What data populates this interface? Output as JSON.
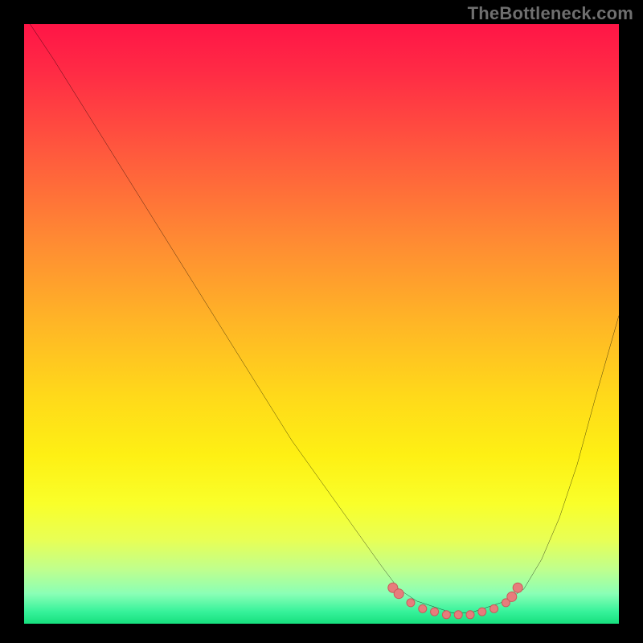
{
  "watermark": "TheBottleneck.com",
  "colors": {
    "frame": "#000000",
    "watermark": "#6f6f6f",
    "curve": "#000000",
    "markers_fill": "#e77c7c",
    "markers_stroke": "#c95a5a",
    "gradient_stops": [
      "#ff1546",
      "#ff2b45",
      "#ff5b3d",
      "#ff8a33",
      "#ffb626",
      "#ffd91a",
      "#fef014",
      "#f9ff2a",
      "#e8ff55",
      "#bfff8e",
      "#8affb6",
      "#36f29a",
      "#17e07e"
    ]
  },
  "chart_data": {
    "type": "line",
    "title": "",
    "xlabel": "",
    "ylabel": "",
    "xlim": [
      0,
      100
    ],
    "ylim": [
      0,
      100
    ],
    "grid": false,
    "legend": false,
    "series": [
      {
        "name": "bottleneck-curve",
        "x": [
          1,
          5,
          10,
          15,
          20,
          25,
          30,
          35,
          40,
          45,
          50,
          55,
          60,
          63,
          66,
          69,
          72,
          75,
          78,
          81,
          84,
          87,
          90,
          93,
          96,
          100
        ],
        "y": [
          100,
          94,
          86,
          78,
          70,
          62,
          54,
          46,
          38,
          30,
          23,
          16,
          9,
          5,
          3,
          2,
          1,
          1,
          2,
          3,
          5,
          10,
          17,
          26,
          37,
          51
        ]
      }
    ],
    "markers": {
      "name": "valley-markers",
      "points": [
        {
          "x": 62,
          "y": 6
        },
        {
          "x": 63,
          "y": 5
        },
        {
          "x": 65,
          "y": 3.5
        },
        {
          "x": 67,
          "y": 2.5
        },
        {
          "x": 69,
          "y": 2
        },
        {
          "x": 71,
          "y": 1.5
        },
        {
          "x": 73,
          "y": 1.5
        },
        {
          "x": 75,
          "y": 1.5
        },
        {
          "x": 77,
          "y": 2
        },
        {
          "x": 79,
          "y": 2.5
        },
        {
          "x": 81,
          "y": 3.5
        },
        {
          "x": 82,
          "y": 4.5
        },
        {
          "x": 83,
          "y": 6
        }
      ]
    },
    "notes": "x is a normalized horizontal position (0–100 across the plot area, left→right); y is a normalized value (0 at the curve’s lowest point, 100 at the top of the plot area). The curve is a steep descending line from top-left into a flat valley around x≈63–81, then rises toward the right. Marker points sit along the valley floor."
  }
}
